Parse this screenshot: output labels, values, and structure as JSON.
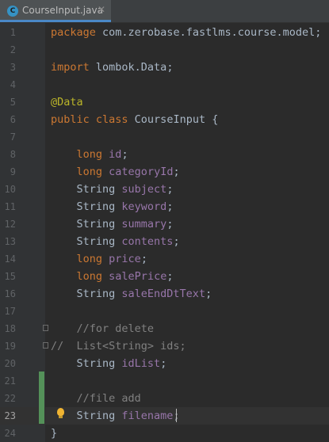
{
  "tab": {
    "title": "CourseInput.java",
    "icon_letter": "C",
    "close": "✕"
  },
  "editor": {
    "current_line": 23,
    "font_color_default": "#a9b7c6"
  },
  "lines": [
    {
      "n": "1",
      "tokens": [
        [
          "kw",
          "package"
        ],
        [
          "pl",
          " com.zerobase.fastlms.course.model;"
        ]
      ]
    },
    {
      "n": "2",
      "tokens": []
    },
    {
      "n": "3",
      "tokens": [
        [
          "kw",
          "import"
        ],
        [
          "pl",
          " lombok.Data;"
        ]
      ]
    },
    {
      "n": "4",
      "tokens": []
    },
    {
      "n": "5",
      "tokens": [
        [
          "an",
          "@Data"
        ]
      ]
    },
    {
      "n": "6",
      "tokens": [
        [
          "kw",
          "public class"
        ],
        [
          "pl",
          " CourseInput {"
        ]
      ]
    },
    {
      "n": "7",
      "tokens": []
    },
    {
      "n": "8",
      "tokens": [
        [
          "pl",
          "    "
        ],
        [
          "kw",
          "long"
        ],
        [
          "pl",
          " "
        ],
        [
          "fld",
          "id"
        ],
        [
          "pl",
          ";"
        ]
      ]
    },
    {
      "n": "9",
      "tokens": [
        [
          "pl",
          "    "
        ],
        [
          "kw",
          "long"
        ],
        [
          "pl",
          " "
        ],
        [
          "fld",
          "categoryId"
        ],
        [
          "pl",
          ";"
        ]
      ]
    },
    {
      "n": "10",
      "tokens": [
        [
          "pl",
          "    String "
        ],
        [
          "fld",
          "subject"
        ],
        [
          "pl",
          ";"
        ]
      ]
    },
    {
      "n": "11",
      "tokens": [
        [
          "pl",
          "    String "
        ],
        [
          "fld",
          "keyword"
        ],
        [
          "pl",
          ";"
        ]
      ]
    },
    {
      "n": "12",
      "tokens": [
        [
          "pl",
          "    String "
        ],
        [
          "fld",
          "summary"
        ],
        [
          "pl",
          ";"
        ]
      ]
    },
    {
      "n": "13",
      "tokens": [
        [
          "pl",
          "    String "
        ],
        [
          "fld",
          "contents"
        ],
        [
          "pl",
          ";"
        ]
      ]
    },
    {
      "n": "14",
      "tokens": [
        [
          "pl",
          "    "
        ],
        [
          "kw",
          "long"
        ],
        [
          "pl",
          " "
        ],
        [
          "fld",
          "price"
        ],
        [
          "pl",
          ";"
        ]
      ]
    },
    {
      "n": "15",
      "tokens": [
        [
          "pl",
          "    "
        ],
        [
          "kw",
          "long"
        ],
        [
          "pl",
          " "
        ],
        [
          "fld",
          "salePrice"
        ],
        [
          "pl",
          ";"
        ]
      ]
    },
    {
      "n": "16",
      "tokens": [
        [
          "pl",
          "    String "
        ],
        [
          "fld",
          "saleEndDtText"
        ],
        [
          "pl",
          ";"
        ]
      ]
    },
    {
      "n": "17",
      "tokens": []
    },
    {
      "n": "18",
      "tokens": [
        [
          "cm",
          "    //for delete"
        ]
      ]
    },
    {
      "n": "19",
      "tokens": [
        [
          "cm",
          "//  List<String> ids;"
        ]
      ]
    },
    {
      "n": "20",
      "tokens": [
        [
          "pl",
          "    String "
        ],
        [
          "fld",
          "idList"
        ],
        [
          "pl",
          ";"
        ]
      ]
    },
    {
      "n": "21",
      "tokens": []
    },
    {
      "n": "22",
      "tokens": [
        [
          "cm",
          "    //file add"
        ]
      ]
    },
    {
      "n": "23",
      "tokens": [
        [
          "pl",
          "    String "
        ],
        [
          "fld",
          "filename"
        ],
        [
          "pl",
          ";"
        ]
      ]
    },
    {
      "n": "24",
      "tokens": [
        [
          "pl",
          "}"
        ]
      ]
    }
  ]
}
